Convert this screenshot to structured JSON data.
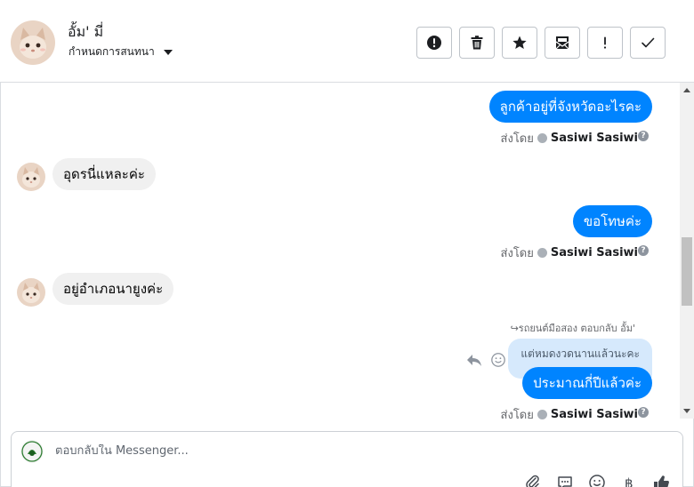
{
  "header": {
    "contact_name": "อั้ม' มี่",
    "conversation_settings": "กำหนดการสนทนา"
  },
  "actions": [
    {
      "name": "mark-spam-button",
      "icon": "exclamation-circle-icon"
    },
    {
      "name": "delete-button",
      "icon": "trash-icon"
    },
    {
      "name": "star-button",
      "icon": "star-icon"
    },
    {
      "name": "mark-unread-button",
      "icon": "envelope-open-icon"
    },
    {
      "name": "flag-button",
      "icon": "exclamation-icon"
    },
    {
      "name": "mark-done-button",
      "icon": "check-icon"
    }
  ],
  "messages": {
    "m1": "ลูกค้าอยู่ที่จังหวัดอะไรคะ",
    "m1_sent_by": "ส่งโดย",
    "m1_sender": "Sasiwi Sasiwi",
    "m2": "อุดรนี่แหละค่ะ",
    "m3": "ขอโทษค่ะ",
    "m3_sent_by": "ส่งโดย",
    "m3_sender": "Sasiwi Sasiwi",
    "m4": "อยู่อำเภอนายูงค่ะ",
    "reply_meta": "รถยนต์มือสอง ตอบกลับ อั้ม'",
    "reply_quote": "แต่หมดงวดนานแล้วนะคะ",
    "m5": "ประมาณกี่ปีแล้วค่ะ",
    "m5_sent_by": "ส่งโดย",
    "m5_sender": "Sasiwi Sasiwi"
  },
  "composer": {
    "placeholder": "ตอบกลับใน Messenger..."
  },
  "colors": {
    "outgoing_bubble": "#0084ff",
    "incoming_bubble": "#f0f0f0",
    "reply_quote": "#d6e9fc"
  }
}
